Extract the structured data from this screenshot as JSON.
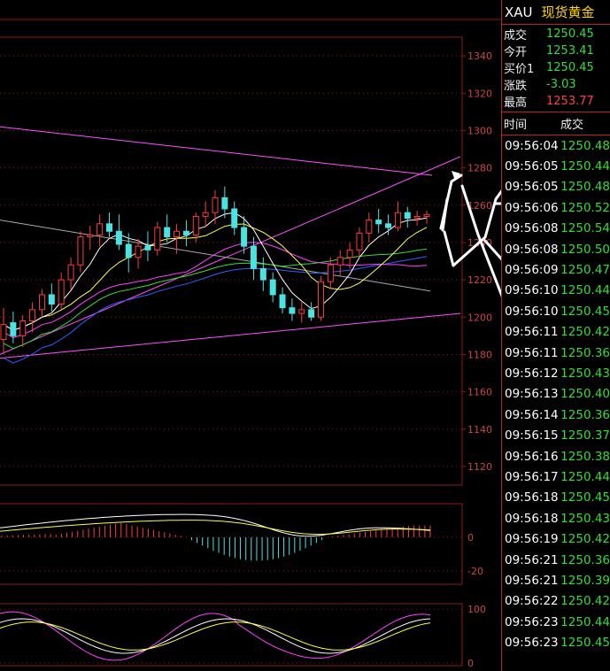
{
  "colors": {
    "grid": "#8b1a1a",
    "up": "#ff3b3b",
    "down": "#49e3e3",
    "ma_fast": "#ffffff",
    "ma_yellow": "#ffff40",
    "ma_magenta": "#ff40ff",
    "ma_green": "#30e030",
    "ma_blue": "#3060ff",
    "trend": "#ff50ff",
    "dif": "#ffffff",
    "dea": "#ffff40",
    "k": "#ffffff",
    "d": "#ffff40",
    "j": "#ff40ff"
  },
  "symbol": {
    "code": "XAU",
    "name": "现货黄金"
  },
  "quotes": [
    {
      "label": "成交",
      "value": "1250.45",
      "tone": "down"
    },
    {
      "label": "今开",
      "value": "1253.41",
      "tone": "down"
    },
    {
      "label": "买价1",
      "value": "1250.45",
      "tone": "down"
    },
    {
      "label": "涨跌",
      "value": "-3.03",
      "tone": "down"
    },
    {
      "label": "最高",
      "value": "1253.77",
      "tone": "up"
    }
  ],
  "ticks_header": {
    "time": "时间",
    "price": "成交"
  },
  "ticks": [
    {
      "time": "09:56:04",
      "price": "1250.48"
    },
    {
      "time": "09:56:05",
      "price": "1250.44"
    },
    {
      "time": "09:56:05",
      "price": "1250.48"
    },
    {
      "time": "09:56:06",
      "price": "1250.52"
    },
    {
      "time": "09:56:08",
      "price": "1250.54"
    },
    {
      "time": "09:56:08",
      "price": "1250.50"
    },
    {
      "time": "09:56:09",
      "price": "1250.47"
    },
    {
      "time": "09:56:10",
      "price": "1250.44"
    },
    {
      "time": "09:56:10",
      "price": "1250.45"
    },
    {
      "time": "09:56:11",
      "price": "1250.42"
    },
    {
      "time": "09:56:11",
      "price": "1250.36"
    },
    {
      "time": "09:56:12",
      "price": "1250.43"
    },
    {
      "time": "09:56:13",
      "price": "1250.40"
    },
    {
      "time": "09:56:14",
      "price": "1250.36"
    },
    {
      "time": "09:56:15",
      "price": "1250.37"
    },
    {
      "time": "09:56:16",
      "price": "1250.38"
    },
    {
      "time": "09:56:17",
      "price": "1250.44"
    },
    {
      "time": "09:56:18",
      "price": "1250.45"
    },
    {
      "time": "09:56:18",
      "price": "1250.43"
    },
    {
      "time": "09:56:19",
      "price": "1250.42"
    },
    {
      "time": "09:56:21",
      "price": "1250.36"
    },
    {
      "time": "09:56:21",
      "price": "1250.39"
    },
    {
      "time": "09:56:22",
      "price": "1250.42"
    },
    {
      "time": "09:56:23",
      "price": "1250.44"
    },
    {
      "time": "09:56:23",
      "price": "1250.45"
    }
  ],
  "chart_data": [
    {
      "type": "candlestick",
      "panel": "price",
      "y_ticks": [
        1340,
        1320,
        1300,
        1280,
        1260,
        1240,
        1220,
        1200,
        1180,
        1160,
        1140,
        1120
      ],
      "ylim": [
        1110,
        1350
      ],
      "candles": [
        {
          "o": 1188,
          "h": 1205,
          "l": 1180,
          "c": 1196
        },
        {
          "o": 1197,
          "h": 1203,
          "l": 1186,
          "c": 1190
        },
        {
          "o": 1190,
          "h": 1201,
          "l": 1184,
          "c": 1198
        },
        {
          "o": 1198,
          "h": 1208,
          "l": 1192,
          "c": 1204
        },
        {
          "o": 1204,
          "h": 1215,
          "l": 1200,
          "c": 1212
        },
        {
          "o": 1212,
          "h": 1218,
          "l": 1203,
          "c": 1207
        },
        {
          "o": 1207,
          "h": 1224,
          "l": 1204,
          "c": 1220
        },
        {
          "o": 1220,
          "h": 1232,
          "l": 1215,
          "c": 1228
        },
        {
          "o": 1228,
          "h": 1246,
          "l": 1224,
          "c": 1243
        },
        {
          "o": 1243,
          "h": 1249,
          "l": 1236,
          "c": 1244
        },
        {
          "o": 1244,
          "h": 1255,
          "l": 1238,
          "c": 1250
        },
        {
          "o": 1250,
          "h": 1256,
          "l": 1243,
          "c": 1246
        },
        {
          "o": 1246,
          "h": 1255,
          "l": 1236,
          "c": 1239
        },
        {
          "o": 1239,
          "h": 1245,
          "l": 1224,
          "c": 1232
        },
        {
          "o": 1232,
          "h": 1242,
          "l": 1226,
          "c": 1238
        },
        {
          "o": 1238,
          "h": 1246,
          "l": 1230,
          "c": 1236
        },
        {
          "o": 1236,
          "h": 1251,
          "l": 1233,
          "c": 1248
        },
        {
          "o": 1248,
          "h": 1255,
          "l": 1240,
          "c": 1243
        },
        {
          "o": 1243,
          "h": 1250,
          "l": 1234,
          "c": 1246
        },
        {
          "o": 1246,
          "h": 1252,
          "l": 1238,
          "c": 1244
        },
        {
          "o": 1244,
          "h": 1256,
          "l": 1240,
          "c": 1254
        },
        {
          "o": 1254,
          "h": 1262,
          "l": 1248,
          "c": 1256
        },
        {
          "o": 1256,
          "h": 1268,
          "l": 1250,
          "c": 1264
        },
        {
          "o": 1264,
          "h": 1270,
          "l": 1253,
          "c": 1258
        },
        {
          "o": 1258,
          "h": 1262,
          "l": 1244,
          "c": 1248
        },
        {
          "o": 1248,
          "h": 1254,
          "l": 1234,
          "c": 1238
        },
        {
          "o": 1238,
          "h": 1243,
          "l": 1220,
          "c": 1226
        },
        {
          "o": 1226,
          "h": 1232,
          "l": 1214,
          "c": 1220
        },
        {
          "o": 1220,
          "h": 1224,
          "l": 1208,
          "c": 1212
        },
        {
          "o": 1212,
          "h": 1216,
          "l": 1202,
          "c": 1205
        },
        {
          "o": 1205,
          "h": 1210,
          "l": 1198,
          "c": 1202
        },
        {
          "o": 1202,
          "h": 1208,
          "l": 1197,
          "c": 1204
        },
        {
          "o": 1204,
          "h": 1208,
          "l": 1198,
          "c": 1200
        },
        {
          "o": 1200,
          "h": 1222,
          "l": 1198,
          "c": 1219
        },
        {
          "o": 1219,
          "h": 1232,
          "l": 1215,
          "c": 1228
        },
        {
          "o": 1228,
          "h": 1236,
          "l": 1222,
          "c": 1232
        },
        {
          "o": 1232,
          "h": 1240,
          "l": 1226,
          "c": 1236
        },
        {
          "o": 1236,
          "h": 1248,
          "l": 1232,
          "c": 1245
        },
        {
          "o": 1245,
          "h": 1256,
          "l": 1240,
          "c": 1252
        },
        {
          "o": 1252,
          "h": 1258,
          "l": 1245,
          "c": 1250
        },
        {
          "o": 1250,
          "h": 1255,
          "l": 1244,
          "c": 1248
        },
        {
          "o": 1248,
          "h": 1262,
          "l": 1246,
          "c": 1256
        },
        {
          "o": 1256,
          "h": 1259,
          "l": 1248,
          "c": 1253
        },
        {
          "o": 1253,
          "h": 1257,
          "l": 1249,
          "c": 1254
        },
        {
          "o": 1254,
          "h": 1257,
          "l": 1250,
          "c": 1255
        }
      ]
    },
    {
      "type": "bar",
      "panel": "macd",
      "y_ticks": [
        0,
        -20
      ],
      "ylim": [
        -28,
        20
      ]
    },
    {
      "type": "line",
      "panel": "kdj",
      "y_ticks": [
        100,
        0
      ],
      "ylim": [
        -5,
        110
      ]
    }
  ]
}
